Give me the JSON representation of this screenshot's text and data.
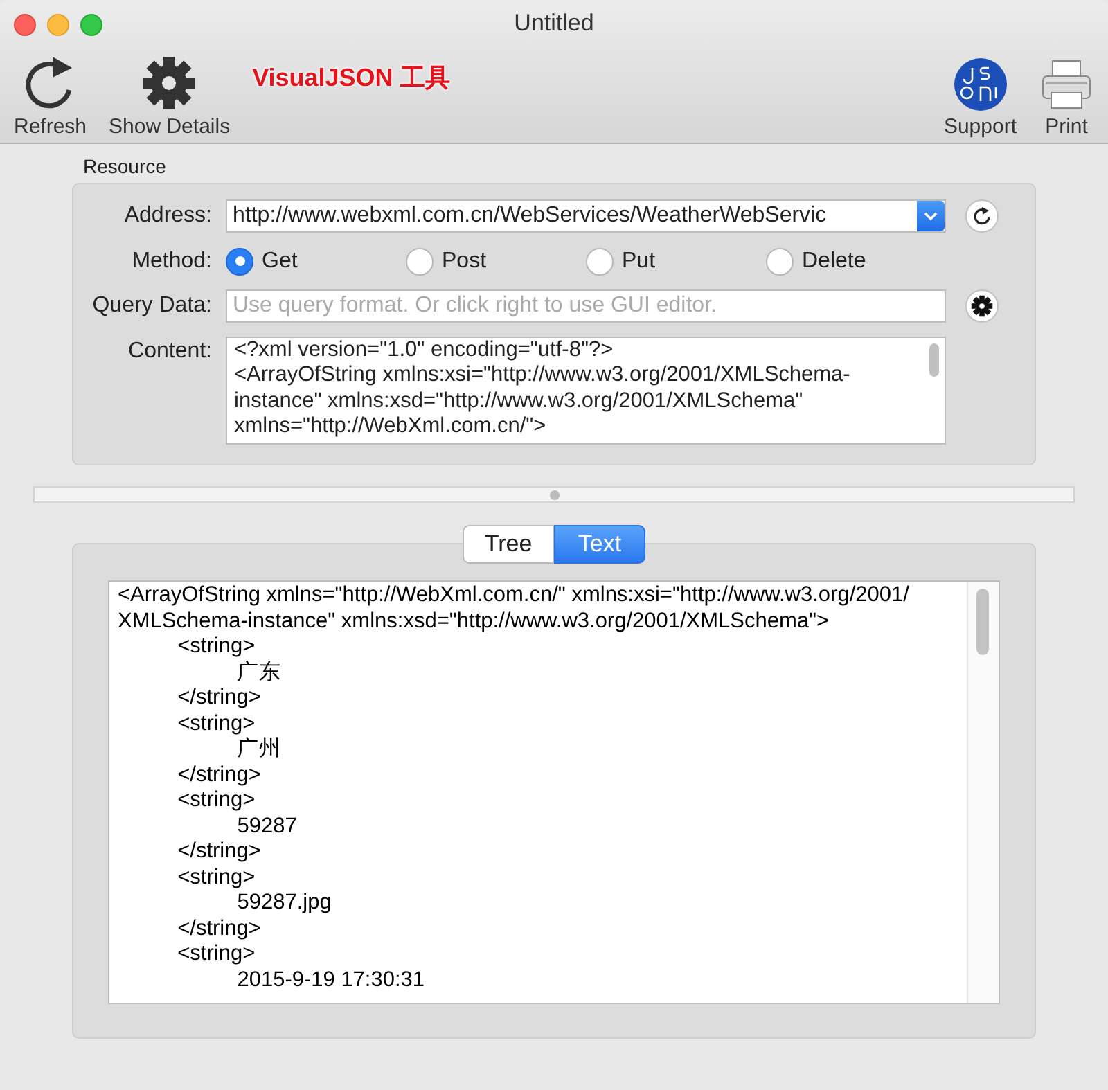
{
  "window": {
    "title": "Untitled"
  },
  "toolbar": {
    "left": [
      {
        "kind": "refresh",
        "label": "Refresh"
      },
      {
        "kind": "gear",
        "label": "Show Details"
      }
    ],
    "right": [
      {
        "kind": "json",
        "label": "Support"
      },
      {
        "kind": "printer",
        "label": "Print"
      }
    ]
  },
  "annotation": "VisualJSON 工具",
  "resource": {
    "title": "Resource",
    "address": {
      "label": "Address:",
      "value": "http://www.webxml.com.cn/WebServices/WeatherWebServic"
    },
    "method": {
      "label": "Method:",
      "options": [
        {
          "label": "Get",
          "selected": true
        },
        {
          "label": "Post",
          "selected": false
        },
        {
          "label": "Put",
          "selected": false
        },
        {
          "label": "Delete",
          "selected": false
        }
      ]
    },
    "query": {
      "label": "Query Data:",
      "placeholder": "Use query format. Or click right to use GUI editor."
    },
    "content": {
      "label": "Content:",
      "lines": [
        "<?xml version=\"1.0\" encoding=\"utf-8\"?>",
        "<ArrayOfString xmlns:xsi=\"http://www.w3.org/2001/XMLSchema-",
        "instance\" xmlns:xsd=\"http://www.w3.org/2001/XMLSchema\"",
        "xmlns=\"http://WebXml.com.cn/\">"
      ]
    }
  },
  "view_tabs": [
    {
      "label": "Tree",
      "selected": false
    },
    {
      "label": "Text",
      "selected": true
    }
  ],
  "result": {
    "lines": [
      "<ArrayOfString xmlns=\"http://WebXml.com.cn/\" xmlns:xsi=\"http://www.w3.org/2001/",
      "XMLSchema-instance\" xmlns:xsd=\"http://www.w3.org/2001/XMLSchema\">",
      "\t<string>",
      "\t\t广东",
      "\t</string>",
      "\t<string>",
      "\t\t广州",
      "\t</string>",
      "\t<string>",
      "\t\t59287",
      "\t</string>",
      "\t<string>",
      "\t\t59287.jpg",
      "\t</string>",
      "\t<string>",
      "\t\t2015-9-19 17:30:31"
    ]
  }
}
